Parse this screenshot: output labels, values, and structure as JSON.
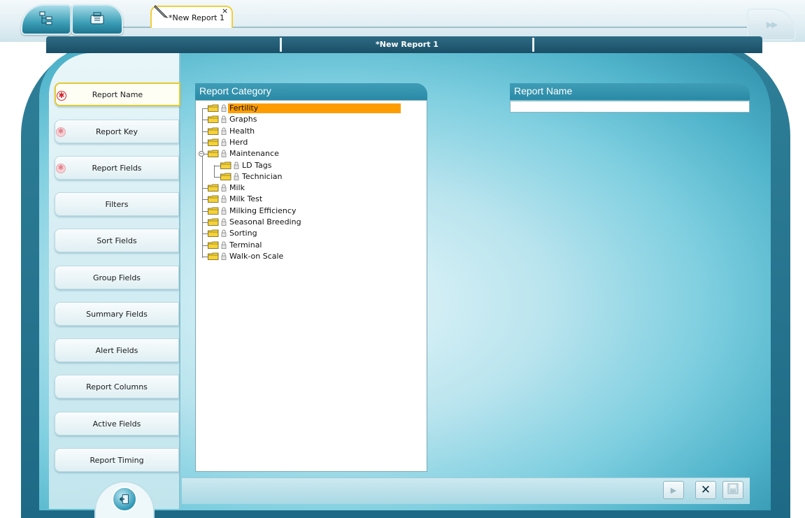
{
  "document_tab": {
    "title": "*New Report 1",
    "close": "×"
  },
  "header": {
    "title": "*New Report 1"
  },
  "nav": {
    "items": [
      {
        "label": "Report Name",
        "required": "on"
      },
      {
        "label": "Report Key",
        "required": "off"
      },
      {
        "label": "Report Fields",
        "required": "off"
      },
      {
        "label": "Filters"
      },
      {
        "label": "Sort Fields"
      },
      {
        "label": "Group Fields"
      },
      {
        "label": "Summary Fields"
      },
      {
        "label": "Alert Fields"
      },
      {
        "label": "Report Columns"
      },
      {
        "label": "Active Fields"
      },
      {
        "label": "Report Timing"
      }
    ]
  },
  "category": {
    "heading": "Report Category",
    "items": [
      {
        "label": "Fertility",
        "selected": true,
        "level": 0
      },
      {
        "label": "Graphs",
        "level": 0
      },
      {
        "label": "Health",
        "level": 0
      },
      {
        "label": "Herd",
        "level": 0
      },
      {
        "label": "Maintenance",
        "level": 0,
        "expanded": true
      },
      {
        "label": "LD Tags",
        "level": 1
      },
      {
        "label": "Technician",
        "level": 1
      },
      {
        "label": "Milk",
        "level": 0
      },
      {
        "label": "Milk Test",
        "level": 0
      },
      {
        "label": "Milking Efficiency",
        "level": 0
      },
      {
        "label": "Seasonal Breeding",
        "level": 0
      },
      {
        "label": "Sorting",
        "level": 0
      },
      {
        "label": "Terminal",
        "level": 0
      },
      {
        "label": "Walk-on Scale",
        "level": 0
      }
    ]
  },
  "report_name": {
    "heading": "Report Name",
    "value": ""
  },
  "colors": {
    "selection": "#ff9d00",
    "accent": "#2a8aa6",
    "active_border": "#e6c930",
    "required": "#d1262c"
  },
  "icons": [
    "tree-view-icon",
    "toolbox-icon",
    "pencil-icon",
    "forward-icon",
    "exit-door-icon",
    "run-icon",
    "cancel-icon",
    "save-icon",
    "folder-icon",
    "lock-icon"
  ]
}
